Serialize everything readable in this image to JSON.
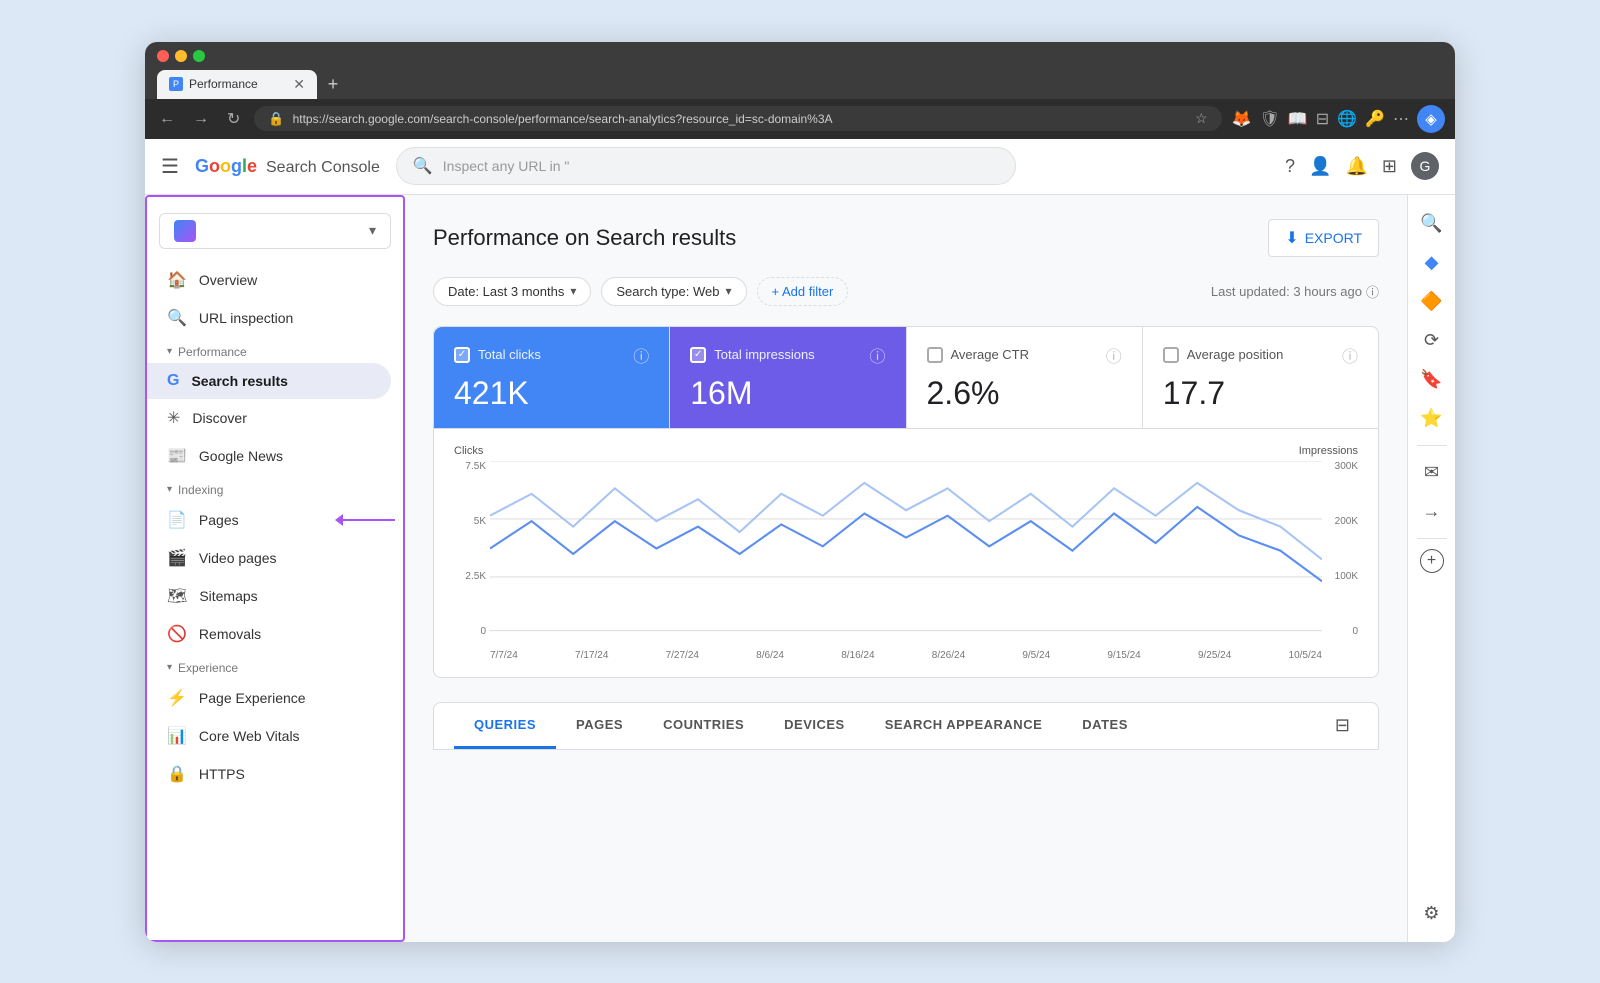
{
  "browser": {
    "tab_label": "Performance",
    "address": "https://search.google.com/search-console/performance/search-analytics?resource_id=sc-domain%3A",
    "nav_back": "←",
    "nav_forward": "→",
    "nav_refresh": "↻"
  },
  "header": {
    "menu_icon": "≡",
    "logo_text": "Google Search Console",
    "search_placeholder": "Inspect any URL in \"",
    "help_icon": "?",
    "users_icon": "👤",
    "bell_icon": "🔔",
    "apps_icon": "⊞",
    "avatar_text": "G"
  },
  "sidebar": {
    "property_name": "",
    "property_arrow": "▾",
    "overview_label": "Overview",
    "url_inspection_label": "URL inspection",
    "performance_section": "Performance",
    "search_results_label": "Search results",
    "discover_label": "Discover",
    "google_news_label": "Google News",
    "indexing_section": "Indexing",
    "pages_label": "Pages",
    "video_pages_label": "Video pages",
    "sitemaps_label": "Sitemaps",
    "removals_label": "Removals",
    "experience_section": "Experience",
    "page_experience_label": "Page Experience",
    "core_web_vitals_label": "Core Web Vitals",
    "https_label": "HTTPS"
  },
  "main": {
    "page_title": "Performance on Search results",
    "export_label": "EXPORT",
    "filter_date": "Date: Last 3 months",
    "filter_search_type": "Search type: Web",
    "add_filter_label": "+ Add filter",
    "last_updated": "Last updated: 3 hours ago",
    "stats": {
      "total_clicks_label": "Total clicks",
      "total_clicks_value": "421K",
      "total_impressions_label": "Total impressions",
      "total_impressions_value": "16M",
      "avg_ctr_label": "Average CTR",
      "avg_ctr_value": "2.6%",
      "avg_position_label": "Average position",
      "avg_position_value": "17.7"
    },
    "chart": {
      "y_axis_left_label": "Clicks",
      "y_axis_right_label": "Impressions",
      "y_left_values": [
        "7.5K",
        "5K",
        "2.5K",
        "0"
      ],
      "y_right_values": [
        "300K",
        "200K",
        "100K",
        "0"
      ],
      "x_labels": [
        "7/7/24",
        "7/17/24",
        "7/27/24",
        "8/6/24",
        "8/16/24",
        "8/26/24",
        "9/5/24",
        "9/15/24",
        "9/25/24",
        "10/5/24"
      ]
    },
    "tabs": [
      "QUERIES",
      "PAGES",
      "COUNTRIES",
      "DEVICES",
      "SEARCH APPEARANCE",
      "DATES"
    ],
    "active_tab": "QUERIES"
  },
  "right_panel": {
    "search_icon": "🔍",
    "blue_icon": "◆",
    "orange_icon": "🔷",
    "refresh_icon": "⟳",
    "bookmark_icon": "🔖",
    "star_icon": "★",
    "mail_icon": "✉",
    "arrow_icon": "→",
    "add_icon": "+",
    "settings_icon": "⚙"
  }
}
